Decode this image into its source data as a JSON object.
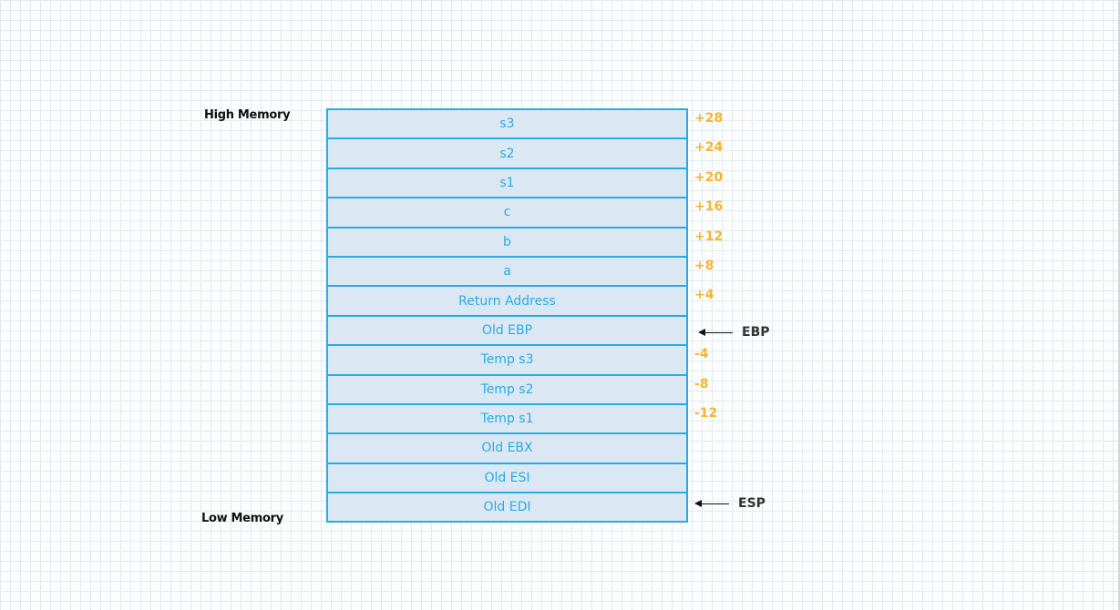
{
  "labels": {
    "high": "High Memory",
    "low": "Low Memory"
  },
  "cells": [
    "s3",
    "s2",
    "s1",
    "c",
    "b",
    "a",
    "Return Address",
    "Old EBP",
    "Temp s3",
    "Temp s2",
    "Temp s1",
    "Old EBX",
    "Old ESI",
    "Old EDI"
  ],
  "offsets": [
    "+28",
    "+24",
    "+20",
    "+16",
    "+12",
    "+8",
    "+4",
    "",
    "-4",
    "-8",
    "-12",
    "",
    "",
    ""
  ],
  "pointers": {
    "ebp": "EBP",
    "esp": "ESP"
  },
  "colors": {
    "cell_text": "#29abe2",
    "offset": "#f7b52b"
  }
}
